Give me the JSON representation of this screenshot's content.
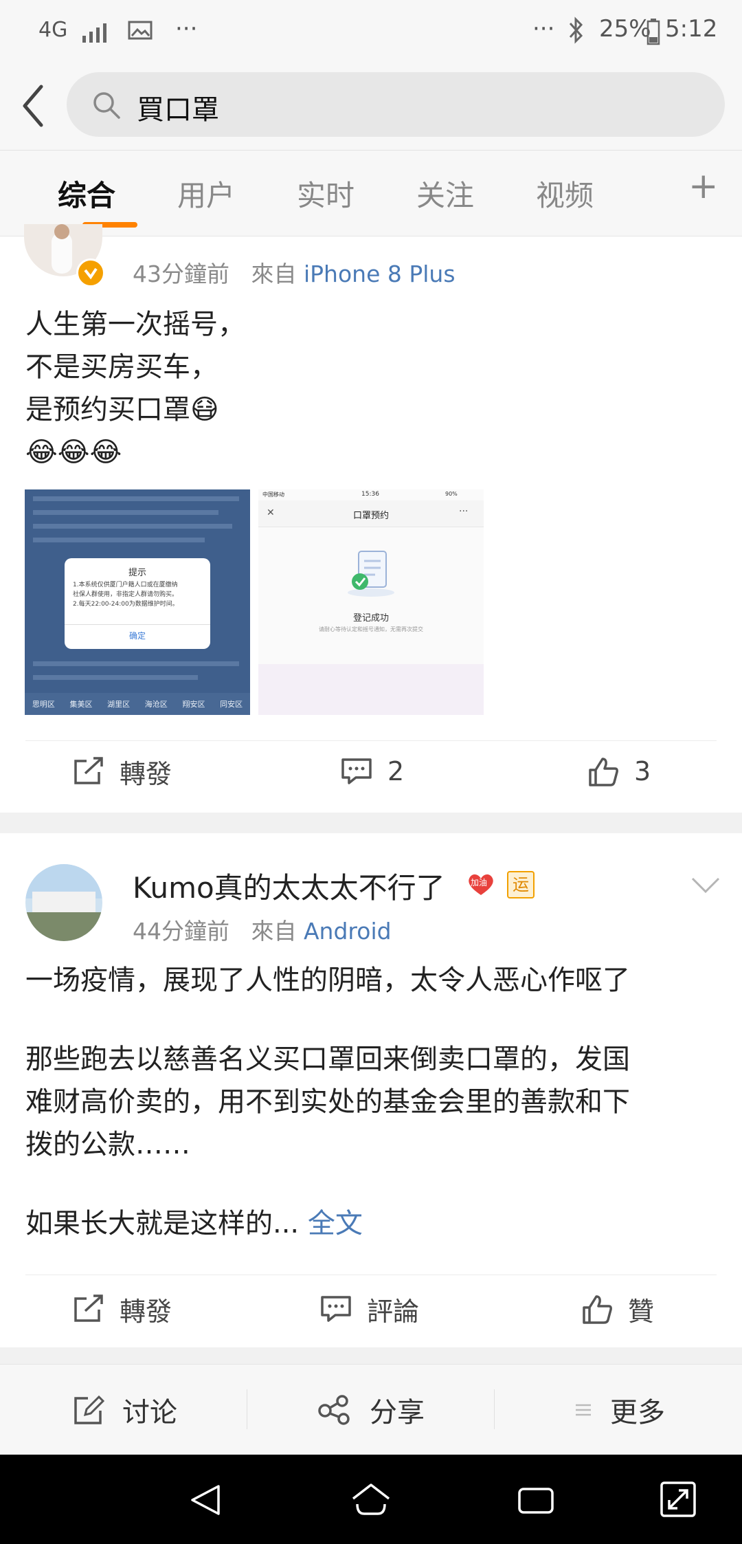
{
  "status_bar": {
    "network": "4G",
    "overflow_left": "···",
    "overflow_right": "···",
    "battery": "25%",
    "time": "5:12"
  },
  "search": {
    "query": "買口罩",
    "icons": [
      "back-arrow-icon",
      "search-icon"
    ]
  },
  "tabs": [
    {
      "label": "综合",
      "active": true
    },
    {
      "label": "用户",
      "active": false
    },
    {
      "label": "实时",
      "active": false
    },
    {
      "label": "关注",
      "active": false
    },
    {
      "label": "视频",
      "active": false
    }
  ],
  "tab_add": "+",
  "accent_color": "#ff8200",
  "link_color": "#4a7ab6",
  "posts": [
    {
      "time": "43分鐘前",
      "source_prefix": "來自",
      "source": "iPhone 8 Plus",
      "verified": true,
      "text_lines": [
        "人生第一次摇号，",
        "不是买房买车，",
        "是预约买口罩😷",
        "😂😂😂"
      ],
      "image1": {
        "dialog_title": "提示",
        "dialog_line1": "1.本系统仅供厦门户籍人口或在厦缴纳",
        "dialog_line2": "社保人群使用，非指定人群请勿购买。",
        "dialog_line3": "2.每天22:00-24:00为数据维护时间。",
        "dialog_button": "确定",
        "districts": [
          "思明区",
          "集美区",
          "湖里区",
          "海沧区",
          "翔安区",
          "同安区"
        ]
      },
      "image2": {
        "carrier": "中国移动",
        "clock": "15:36",
        "battery": "90%",
        "close": "✕",
        "title": "口罩预约",
        "more": "···",
        "success": "登记成功",
        "note": "请耐心等待认定和摇号通知，无需再次提交"
      },
      "actions": {
        "repost": "轉發",
        "comments": "2",
        "likes": "3"
      }
    },
    {
      "author": "Kumo真的太太太不行了",
      "badge1": "加油",
      "badge2": "运",
      "time": "44分鐘前",
      "source_prefix": "來自",
      "source": "Android",
      "text_p1": "一场疫情，展现了人性的阴暗，太令人恶心作呕了",
      "text_p2_lines": [
        "那些跑去以慈善名义买口罩回来倒卖口罩的，发国",
        "难财高价卖的，用不到实处的基金会里的善款和下",
        "拨的公款……"
      ],
      "text_p3": "如果长大就是这样的...",
      "read_more": "全文",
      "actions": {
        "repost": "轉發",
        "comment": "評論",
        "like": "贊"
      }
    }
  ],
  "bottom_bar": {
    "discuss": "讨论",
    "share": "分享",
    "more": "更多"
  }
}
